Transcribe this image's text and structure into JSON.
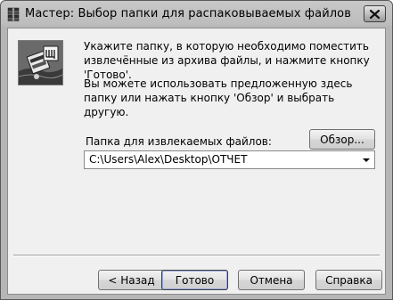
{
  "window": {
    "title": "Мастер:  Выбор папки для распаковываемых файлов",
    "app_icon": "archive-books-icon",
    "close_icon": "close-icon"
  },
  "content": {
    "message1": "Укажите папку, в которую необходимо поместить извлечённые из архива файлы, и нажмите кнопку 'Готово'.",
    "message2": "Вы можете использовать предложенную здесь папку или нажать кнопку 'Обзор' и выбрать другую.",
    "folder_label": "Папка для извлекаемых файлов:",
    "browse_label": "Обзор...",
    "folder_path": "C:\\Users\\Alex\\Desktop\\ОТЧЕТ"
  },
  "buttons": {
    "back": "< Назад",
    "finish": "Готово",
    "cancel": "Отмена",
    "help": "Справка"
  },
  "colors": {
    "dialog_bg": "#f0f0f0",
    "title_bg": "#bdbdbd"
  }
}
